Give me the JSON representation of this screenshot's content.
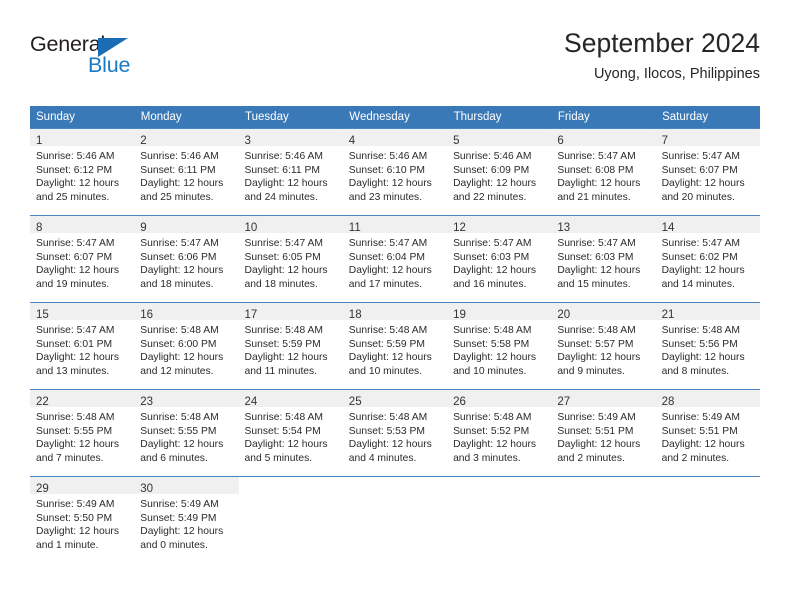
{
  "brand": {
    "word_one": "General",
    "word_two": "Blue",
    "flag_icon": "triangle-flag-icon",
    "color_dark": "#231f20",
    "color_blue": "#1a7ac4"
  },
  "header": {
    "title": "September 2024",
    "subtitle": "Uyong, Ilocos, Philippines"
  },
  "theme": {
    "header_blue": "#3a79b8",
    "row_divider": "#4a86c0",
    "daynum_band": "#f0f0f0"
  },
  "weekdays": [
    "Sunday",
    "Monday",
    "Tuesday",
    "Wednesday",
    "Thursday",
    "Friday",
    "Saturday"
  ],
  "weeks": [
    [
      {
        "day": "1",
        "sunrise": "Sunrise: 5:46 AM",
        "sunset": "Sunset: 6:12 PM",
        "daylight_1": "Daylight: 12 hours",
        "daylight_2": "and 25 minutes."
      },
      {
        "day": "2",
        "sunrise": "Sunrise: 5:46 AM",
        "sunset": "Sunset: 6:11 PM",
        "daylight_1": "Daylight: 12 hours",
        "daylight_2": "and 25 minutes."
      },
      {
        "day": "3",
        "sunrise": "Sunrise: 5:46 AM",
        "sunset": "Sunset: 6:11 PM",
        "daylight_1": "Daylight: 12 hours",
        "daylight_2": "and 24 minutes."
      },
      {
        "day": "4",
        "sunrise": "Sunrise: 5:46 AM",
        "sunset": "Sunset: 6:10 PM",
        "daylight_1": "Daylight: 12 hours",
        "daylight_2": "and 23 minutes."
      },
      {
        "day": "5",
        "sunrise": "Sunrise: 5:46 AM",
        "sunset": "Sunset: 6:09 PM",
        "daylight_1": "Daylight: 12 hours",
        "daylight_2": "and 22 minutes."
      },
      {
        "day": "6",
        "sunrise": "Sunrise: 5:47 AM",
        "sunset": "Sunset: 6:08 PM",
        "daylight_1": "Daylight: 12 hours",
        "daylight_2": "and 21 minutes."
      },
      {
        "day": "7",
        "sunrise": "Sunrise: 5:47 AM",
        "sunset": "Sunset: 6:07 PM",
        "daylight_1": "Daylight: 12 hours",
        "daylight_2": "and 20 minutes."
      }
    ],
    [
      {
        "day": "8",
        "sunrise": "Sunrise: 5:47 AM",
        "sunset": "Sunset: 6:07 PM",
        "daylight_1": "Daylight: 12 hours",
        "daylight_2": "and 19 minutes."
      },
      {
        "day": "9",
        "sunrise": "Sunrise: 5:47 AM",
        "sunset": "Sunset: 6:06 PM",
        "daylight_1": "Daylight: 12 hours",
        "daylight_2": "and 18 minutes."
      },
      {
        "day": "10",
        "sunrise": "Sunrise: 5:47 AM",
        "sunset": "Sunset: 6:05 PM",
        "daylight_1": "Daylight: 12 hours",
        "daylight_2": "and 18 minutes."
      },
      {
        "day": "11",
        "sunrise": "Sunrise: 5:47 AM",
        "sunset": "Sunset: 6:04 PM",
        "daylight_1": "Daylight: 12 hours",
        "daylight_2": "and 17 minutes."
      },
      {
        "day": "12",
        "sunrise": "Sunrise: 5:47 AM",
        "sunset": "Sunset: 6:03 PM",
        "daylight_1": "Daylight: 12 hours",
        "daylight_2": "and 16 minutes."
      },
      {
        "day": "13",
        "sunrise": "Sunrise: 5:47 AM",
        "sunset": "Sunset: 6:03 PM",
        "daylight_1": "Daylight: 12 hours",
        "daylight_2": "and 15 minutes."
      },
      {
        "day": "14",
        "sunrise": "Sunrise: 5:47 AM",
        "sunset": "Sunset: 6:02 PM",
        "daylight_1": "Daylight: 12 hours",
        "daylight_2": "and 14 minutes."
      }
    ],
    [
      {
        "day": "15",
        "sunrise": "Sunrise: 5:47 AM",
        "sunset": "Sunset: 6:01 PM",
        "daylight_1": "Daylight: 12 hours",
        "daylight_2": "and 13 minutes."
      },
      {
        "day": "16",
        "sunrise": "Sunrise: 5:48 AM",
        "sunset": "Sunset: 6:00 PM",
        "daylight_1": "Daylight: 12 hours",
        "daylight_2": "and 12 minutes."
      },
      {
        "day": "17",
        "sunrise": "Sunrise: 5:48 AM",
        "sunset": "Sunset: 5:59 PM",
        "daylight_1": "Daylight: 12 hours",
        "daylight_2": "and 11 minutes."
      },
      {
        "day": "18",
        "sunrise": "Sunrise: 5:48 AM",
        "sunset": "Sunset: 5:59 PM",
        "daylight_1": "Daylight: 12 hours",
        "daylight_2": "and 10 minutes."
      },
      {
        "day": "19",
        "sunrise": "Sunrise: 5:48 AM",
        "sunset": "Sunset: 5:58 PM",
        "daylight_1": "Daylight: 12 hours",
        "daylight_2": "and 10 minutes."
      },
      {
        "day": "20",
        "sunrise": "Sunrise: 5:48 AM",
        "sunset": "Sunset: 5:57 PM",
        "daylight_1": "Daylight: 12 hours",
        "daylight_2": "and 9 minutes."
      },
      {
        "day": "21",
        "sunrise": "Sunrise: 5:48 AM",
        "sunset": "Sunset: 5:56 PM",
        "daylight_1": "Daylight: 12 hours",
        "daylight_2": "and 8 minutes."
      }
    ],
    [
      {
        "day": "22",
        "sunrise": "Sunrise: 5:48 AM",
        "sunset": "Sunset: 5:55 PM",
        "daylight_1": "Daylight: 12 hours",
        "daylight_2": "and 7 minutes."
      },
      {
        "day": "23",
        "sunrise": "Sunrise: 5:48 AM",
        "sunset": "Sunset: 5:55 PM",
        "daylight_1": "Daylight: 12 hours",
        "daylight_2": "and 6 minutes."
      },
      {
        "day": "24",
        "sunrise": "Sunrise: 5:48 AM",
        "sunset": "Sunset: 5:54 PM",
        "daylight_1": "Daylight: 12 hours",
        "daylight_2": "and 5 minutes."
      },
      {
        "day": "25",
        "sunrise": "Sunrise: 5:48 AM",
        "sunset": "Sunset: 5:53 PM",
        "daylight_1": "Daylight: 12 hours",
        "daylight_2": "and 4 minutes."
      },
      {
        "day": "26",
        "sunrise": "Sunrise: 5:48 AM",
        "sunset": "Sunset: 5:52 PM",
        "daylight_1": "Daylight: 12 hours",
        "daylight_2": "and 3 minutes."
      },
      {
        "day": "27",
        "sunrise": "Sunrise: 5:49 AM",
        "sunset": "Sunset: 5:51 PM",
        "daylight_1": "Daylight: 12 hours",
        "daylight_2": "and 2 minutes."
      },
      {
        "day": "28",
        "sunrise": "Sunrise: 5:49 AM",
        "sunset": "Sunset: 5:51 PM",
        "daylight_1": "Daylight: 12 hours",
        "daylight_2": "and 2 minutes."
      }
    ],
    [
      {
        "day": "29",
        "sunrise": "Sunrise: 5:49 AM",
        "sunset": "Sunset: 5:50 PM",
        "daylight_1": "Daylight: 12 hours",
        "daylight_2": "and 1 minute."
      },
      {
        "day": "30",
        "sunrise": "Sunrise: 5:49 AM",
        "sunset": "Sunset: 5:49 PM",
        "daylight_1": "Daylight: 12 hours",
        "daylight_2": "and 0 minutes."
      },
      {
        "day": "",
        "sunrise": "",
        "sunset": "",
        "daylight_1": "",
        "daylight_2": ""
      },
      {
        "day": "",
        "sunrise": "",
        "sunset": "",
        "daylight_1": "",
        "daylight_2": ""
      },
      {
        "day": "",
        "sunrise": "",
        "sunset": "",
        "daylight_1": "",
        "daylight_2": ""
      },
      {
        "day": "",
        "sunrise": "",
        "sunset": "",
        "daylight_1": "",
        "daylight_2": ""
      },
      {
        "day": "",
        "sunrise": "",
        "sunset": "",
        "daylight_1": "",
        "daylight_2": ""
      }
    ]
  ]
}
